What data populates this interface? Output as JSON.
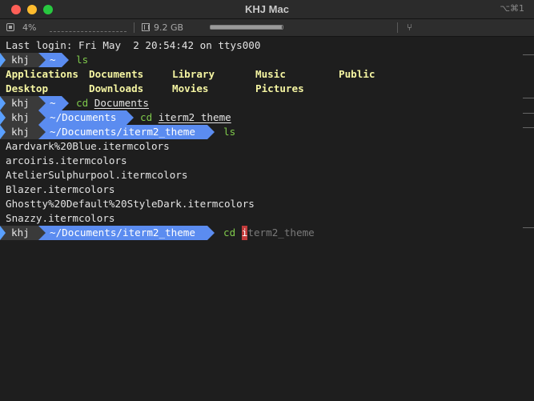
{
  "window": {
    "title": "KHJ Mac",
    "shortcut": "⌥⌘1"
  },
  "statusbar": {
    "cpu": "4%",
    "memory": "9.2 GB",
    "memory_fraction": 0.99
  },
  "terminal": {
    "last_login": "Last login: Fri May  2 20:54:42 on ttys000",
    "user": "khj",
    "prompts": [
      {
        "dir": "~",
        "cmd": "ls",
        "arg": ""
      },
      {
        "dir": "~",
        "cmd": "cd",
        "arg": "Documents"
      },
      {
        "dir": "~/Documents",
        "cmd": "cd",
        "arg": "iterm2_theme"
      },
      {
        "dir": "~/Documents/iterm2_theme",
        "cmd": "ls",
        "arg": ""
      },
      {
        "dir": "~/Documents/iterm2_theme",
        "cmd": "cd",
        "arg_cursor": "i",
        "arg_ghost": "term2_theme"
      }
    ],
    "ls_home": [
      [
        "Applications",
        "Documents",
        "Library",
        "Music",
        "Public"
      ],
      [
        "Desktop",
        "Downloads",
        "Movies",
        "Pictures"
      ]
    ],
    "ls_theme": [
      "Aardvark%20Blue.itermcolors",
      "arcoiris.itermcolors",
      "AtelierSulphurpool.itermcolors",
      "Blazer.itermcolors",
      "Ghostty%20Default%20StyleDark.itermcolors",
      "Snazzy.itermcolors"
    ]
  }
}
